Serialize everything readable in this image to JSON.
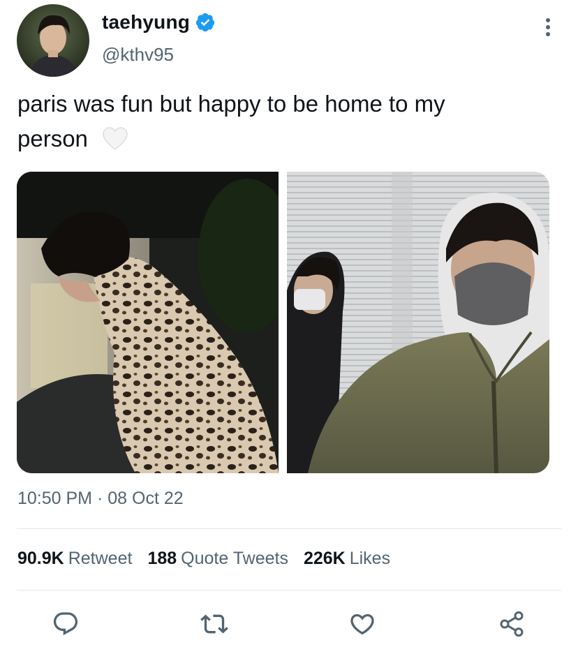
{
  "user": {
    "display_name": "taehyung",
    "handle": "@kthv95",
    "verified": true,
    "avatar_icon": "profile-photo"
  },
  "tweet": {
    "text_line1": "paris was fun but happy to be home to my",
    "text_line2": "person",
    "emoji": "white-heart"
  },
  "media": [
    {
      "name": "photo-leopard-coat",
      "description_icon": "photo"
    },
    {
      "name": "photo-hoodie-selfie",
      "description_icon": "photo"
    }
  ],
  "meta": {
    "time": "10:50 PM",
    "separator": "·",
    "date": "08 Oct 22"
  },
  "stats": {
    "retweets_count": "90.9K",
    "retweets_label": "Retweet",
    "quotes_count": "188",
    "quotes_label": "Quote Tweets",
    "likes_count": "226K",
    "likes_label": "Likes"
  },
  "actions": [
    "reply-icon",
    "retweet-icon",
    "like-icon",
    "share-icon"
  ],
  "colors": {
    "text_primary": "#0f1419",
    "text_secondary": "#536471",
    "verified_blue": "#1d9bf0",
    "divider": "#e1e8ed",
    "icon_gray": "#536471"
  }
}
